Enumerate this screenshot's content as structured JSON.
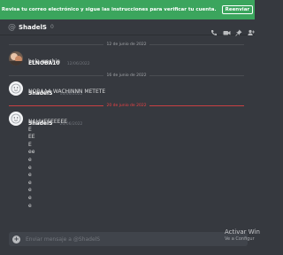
{
  "banner": {
    "text": "Revisa tu correo electrónico y sigue las instrucciones para verificar tu cuenta.",
    "button": "Reenviar"
  },
  "header": {
    "name": "ShadelS",
    "status": "0"
  },
  "dividers": [
    "12 de junio de 2022",
    "16 de junio de 2022",
    "20 de junio de 2022"
  ],
  "messages": [
    {
      "author": "ELNOBA10",
      "time": "12/06/2022",
      "text": "hola wachin"
    },
    {
      "author": "ShadelS",
      "time": "16/06/2022",
      "text": "NOBAAA WACHINNN METETE"
    },
    {
      "author": "ShadelS",
      "time": "20/06/2022",
      "lines": [
        "NAHUEEEEEEE",
        "E",
        "EE",
        "E",
        "ee",
        "e",
        "e",
        "e",
        "e",
        "e",
        "e",
        "e"
      ]
    }
  ],
  "composer": {
    "placeholder": "Enviar mensaje a @ShadelS"
  },
  "watermark": {
    "line1": "Activar Win",
    "line2": "Ve a Configur"
  },
  "colors": {
    "banner": "#3ba55d",
    "background": "#36393f",
    "new_divider": "#ed4245"
  }
}
